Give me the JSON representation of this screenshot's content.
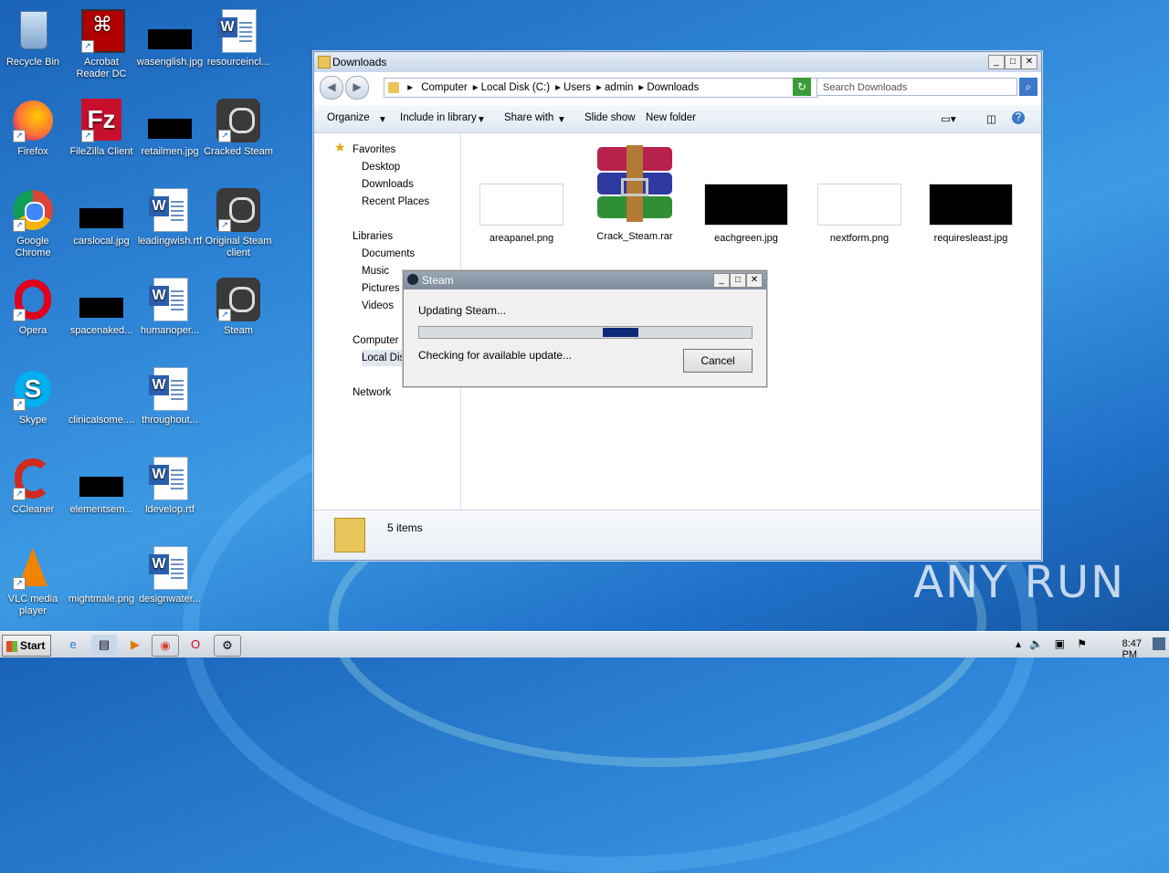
{
  "desktop": {
    "icons": [
      {
        "label": "Recycle Bin"
      },
      {
        "label": "Acrobat Reader DC"
      },
      {
        "label": "wasenglish.jpg"
      },
      {
        "label": "resourceincl..."
      },
      {
        "label": "Firefox"
      },
      {
        "label": "FileZilla Client"
      },
      {
        "label": "retailmen.jpg"
      },
      {
        "label": "Cracked Steam"
      },
      {
        "label": "Google Chrome"
      },
      {
        "label": "carslocal.jpg"
      },
      {
        "label": "leadingwish.rtf"
      },
      {
        "label": "Original Steam client"
      },
      {
        "label": "Opera"
      },
      {
        "label": "spacenaked..."
      },
      {
        "label": "humanoper..."
      },
      {
        "label": "Steam"
      },
      {
        "label": "Skype"
      },
      {
        "label": "clinicalsome...."
      },
      {
        "label": "throughout..."
      },
      {
        "label": "CCleaner"
      },
      {
        "label": "elementsem..."
      },
      {
        "label": "ldevelop.rtf"
      },
      {
        "label": "VLC media player"
      },
      {
        "label": "mightmale.png"
      },
      {
        "label": "designwater..."
      }
    ]
  },
  "explorer": {
    "title": "Downloads",
    "breadcrumb": [
      "Computer",
      "Local Disk (C:)",
      "Users",
      "admin",
      "Downloads"
    ],
    "search_placeholder": "Search Downloads",
    "toolbar": {
      "organize": "Organize",
      "include": "Include in library",
      "share": "Share with",
      "slideshow": "Slide show",
      "newfolder": "New folder"
    },
    "nav": {
      "favorites": "Favorites",
      "desktop": "Desktop",
      "downloads": "Downloads",
      "recent": "Recent Places",
      "libraries": "Libraries",
      "documents": "Documents",
      "music": "Music",
      "pictures": "Pictures",
      "videos": "Videos",
      "computer": "Computer",
      "localdisk": "Local Disk",
      "network": "Network"
    },
    "files": [
      {
        "name": "areapanel.png"
      },
      {
        "name": "Crack_Steam.rar"
      },
      {
        "name": "eachgreen.jpg"
      },
      {
        "name": "nextform.png"
      },
      {
        "name": "requiresleast.jpg"
      }
    ],
    "status": "5 items"
  },
  "steam_dialog": {
    "title": "Steam",
    "message": "Updating Steam...",
    "detail": "Checking for available update...",
    "cancel": "Cancel"
  },
  "taskbar": {
    "start": "Start",
    "clock": "8:47 PM"
  },
  "watermark": "ANY RUN"
}
